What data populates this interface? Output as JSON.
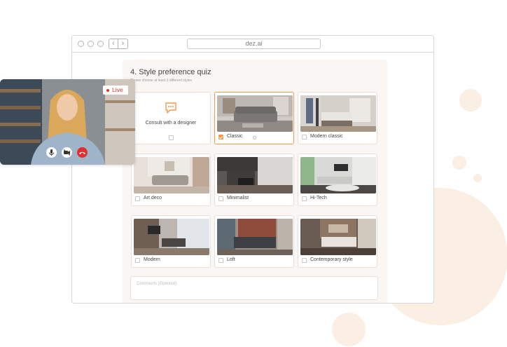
{
  "browser": {
    "url": "dez.ai"
  },
  "quiz": {
    "title": "4. Style preference quiz",
    "subtitle": "Please choose at least 3 different styles",
    "consult_label": "Consult with a designer",
    "styles": [
      {
        "label": "Classic",
        "checked": true
      },
      {
        "label": "Modern classic",
        "checked": false
      },
      {
        "label": "Art deco",
        "checked": false
      },
      {
        "label": "Minimalist",
        "checked": false
      },
      {
        "label": "Hi-Tech",
        "checked": false
      },
      {
        "label": "Modern",
        "checked": false
      },
      {
        "label": "Loft",
        "checked": false
      },
      {
        "label": "Contemporary style",
        "checked": false
      }
    ],
    "comments_placeholder": "Comments (Optional)"
  },
  "video_call": {
    "live_label": "Live"
  },
  "colors": {
    "accent": "#f3994e",
    "live_red": "#e0302b",
    "blob": "#fbeee3"
  }
}
